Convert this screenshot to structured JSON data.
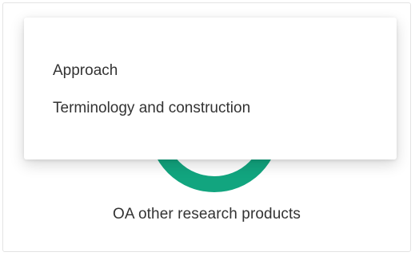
{
  "card": {
    "caption": "OA other research products",
    "accent_color": "#12a57f"
  },
  "menu": {
    "items": [
      {
        "label": "Approach"
      },
      {
        "label": "Terminology and construction"
      }
    ]
  }
}
